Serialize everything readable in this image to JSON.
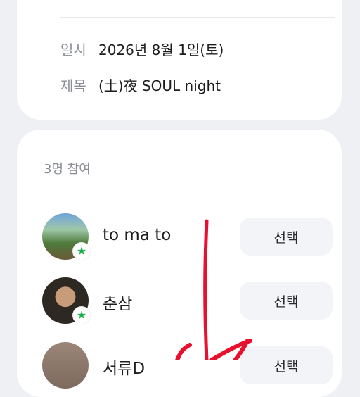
{
  "event_info": {
    "date_label": "일시",
    "date_value": "2026년 8월 1일(토)",
    "title_label": "제목",
    "title_value": "(土)夜 SOUL night"
  },
  "participants": {
    "count_text": "3명 참여",
    "members": [
      {
        "name": "to ma to",
        "is_host": true,
        "button_label": "선택"
      },
      {
        "name": "춘삼",
        "is_host": true,
        "button_label": "선택"
      },
      {
        "name": "서류D",
        "is_host": false,
        "button_label": "선택"
      }
    ]
  },
  "badge_icon": "star-icon",
  "colors": {
    "background": "#eef0f4",
    "card": "#ffffff",
    "host_badge": "#18b24b",
    "annotation": "#e8102c"
  }
}
